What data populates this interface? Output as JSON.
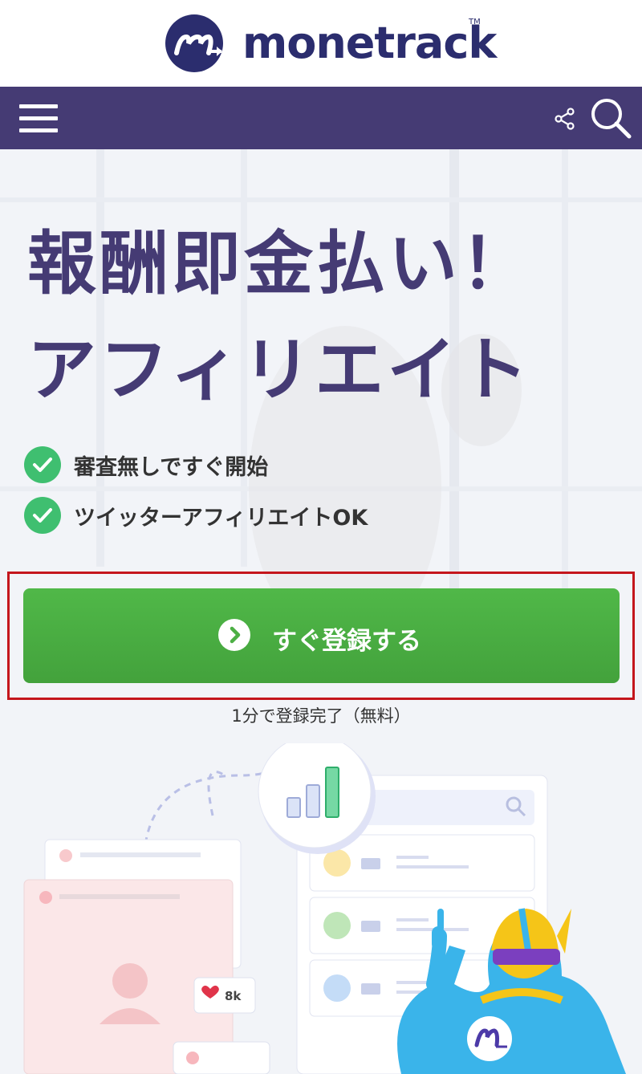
{
  "brand": {
    "name": "monetrack",
    "tm": "TM",
    "color": "#2b2d6e"
  },
  "nav": {
    "color": "#453b74",
    "menu_icon": "hamburger-icon",
    "share_icon": "share-icon",
    "search_icon": "search-icon"
  },
  "hero": {
    "headline_line1": "報酬即金払い！",
    "headline_line2": "アフィリエイト",
    "features": [
      "審査無しですぐ開始",
      "ツイッターアフィリエイトOK"
    ],
    "cta_label": "すぐ登録する",
    "cta_note": "1分で登録完了（無料）",
    "illustration_badge": "8k"
  },
  "colors": {
    "cta": "#4caf44",
    "check": "#3fbf70",
    "headline": "#453b74",
    "highlight": "#c4161c"
  }
}
